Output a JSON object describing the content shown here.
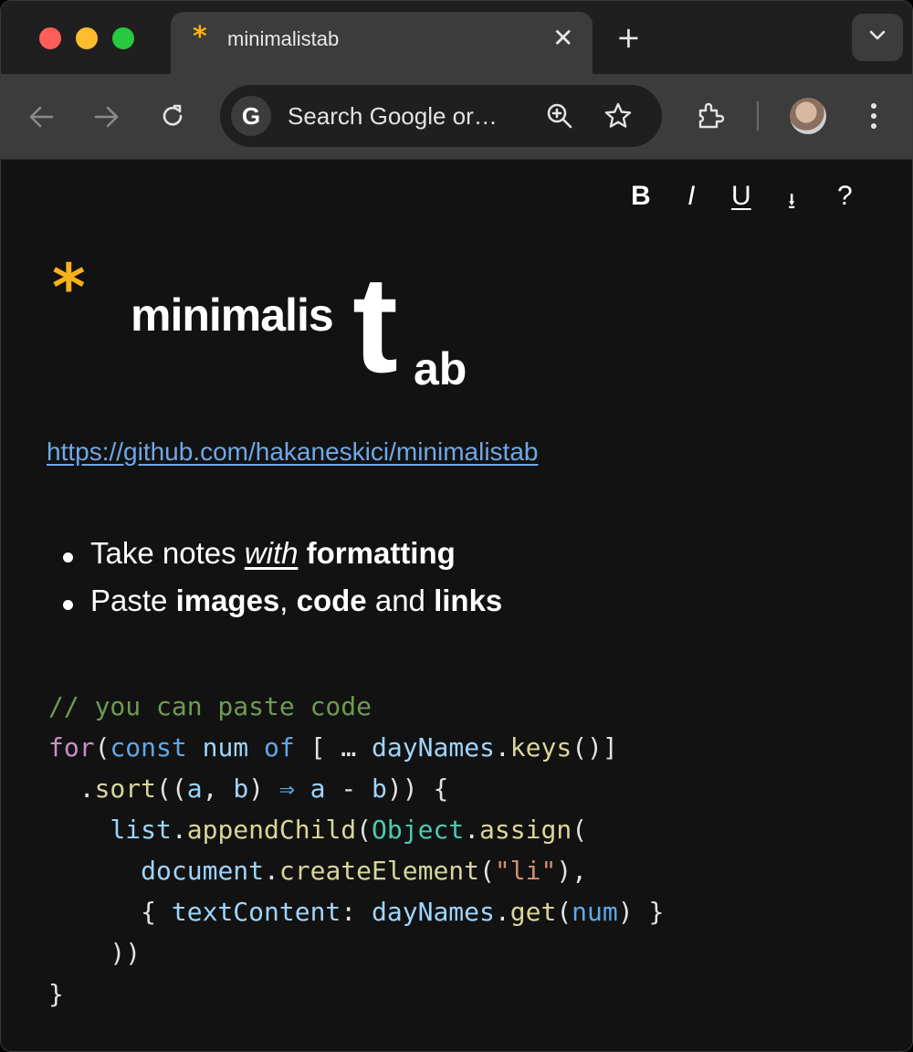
{
  "browser": {
    "tab": {
      "favicon": "*",
      "title": "minimalistab",
      "close": "✕"
    },
    "new_tab": "+",
    "omnibox": {
      "google_badge": "G",
      "placeholder": "Search Google or…"
    }
  },
  "toolbar_format": {
    "bold": "B",
    "italic": "I",
    "underline": "U",
    "download": "⭳",
    "help": "?"
  },
  "logo": {
    "asterisk": "*",
    "main": "minimalis",
    "big_letter": "t",
    "suffix": "ab"
  },
  "link": "https://github.com/hakaneskici/minimalistab",
  "bullets": {
    "b1_take": "Take notes ",
    "b1_with": "with",
    "b1_formatting": "formatting",
    "b2_paste": "Paste ",
    "b2_images": "images",
    "b2_comma": ", ",
    "b2_code": "code",
    "b2_and": " and ",
    "b2_links": "links"
  },
  "code": {
    "comment": "// you can paste code",
    "for_kw": "for",
    "const_kw": "const",
    "num": "num",
    "of_kw": "of",
    "spread": "[ … ",
    "daynames": "dayNames",
    "keys": "keys",
    "sort": "sort",
    "arrow": "⇒",
    "list": "list",
    "appendchild": "appendChild",
    "object": "Object",
    "assign": "assign",
    "document": "document",
    "createelement": "createElement",
    "li": "\"li\"",
    "textcontent": "textContent",
    "get": "get"
  }
}
